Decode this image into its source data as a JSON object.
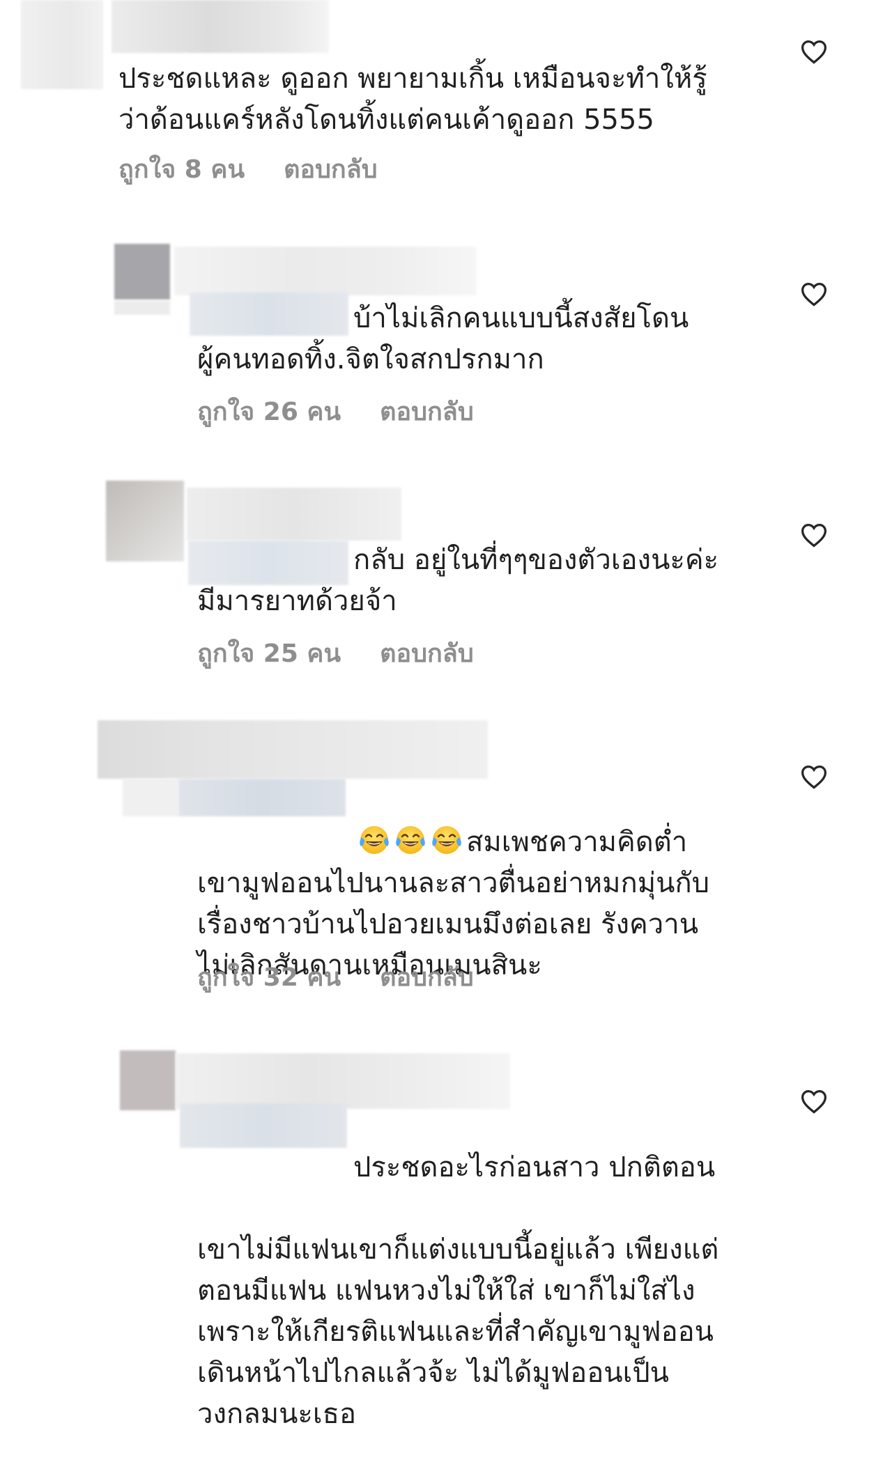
{
  "comments": [
    {
      "text": "ประชดแหละ ดูออก พยายามเกิ้น เหมือนจะทำให้รู้\nว่าด้อนแคร์หลังโดนทิ้งแต่คนเค้าดูออก 5555",
      "likes": "ถูกใจ 8 คน",
      "reply": "ตอบกลับ"
    },
    {
      "text": "บ้าไม่เลิกคนแบบนี้สงสัยโดน\nผู้คนทอดทิ้ง.จิตใจสกปรกมาก",
      "likes": "ถูกใจ 26 คน",
      "reply": "ตอบกลับ"
    },
    {
      "text": "กลับ อยู่ในที่ๆๆของตัวเองนะค่ะ\nมีมารยาทด้วยจ้า",
      "likes": "ถูกใจ 25 คน",
      "reply": "ตอบกลับ"
    },
    {
      "emoji_count": 3,
      "emoji_icon": "face-with-tears-of-joy-icon",
      "text_first": "สมเพชความคิดต่ำ",
      "text_rest": "เขามูฟออนไปนานละสาวตื่นอย่าหมกมุ่นกับ\nเรื่องชาวบ้านไปอวยเมนมึงต่อเลย รังควาน\nไม่เลิกสันดานเหมือนเมนสินะ",
      "likes": "ถูกใจ 32 คน",
      "reply": "ตอบกลับ"
    },
    {
      "text_first": "ประชดอะไรก่อนสาว ปกติตอน",
      "text_rest": "เขาไม่มีแฟนเขาก็แต่งแบบนี้อยู่แล้ว เพียงแต่\nตอนมีแฟน แฟนหวงไม่ให้ใส่ เขาก็ไม่ใส่ไง\nเพราะให้เกียรติแฟนและที่สำคัญเขามูฟออน\nเดินหน้าไปไกลแล้วจ้ะ ไม่ได้มูฟออนเป็น\nวงกลมนะเธอ"
    }
  ],
  "icons": {
    "like": "heart-outline-icon"
  },
  "colors": {
    "text": "#1f1f1f",
    "meta": "#8e8e8e",
    "heart": "#262626"
  }
}
